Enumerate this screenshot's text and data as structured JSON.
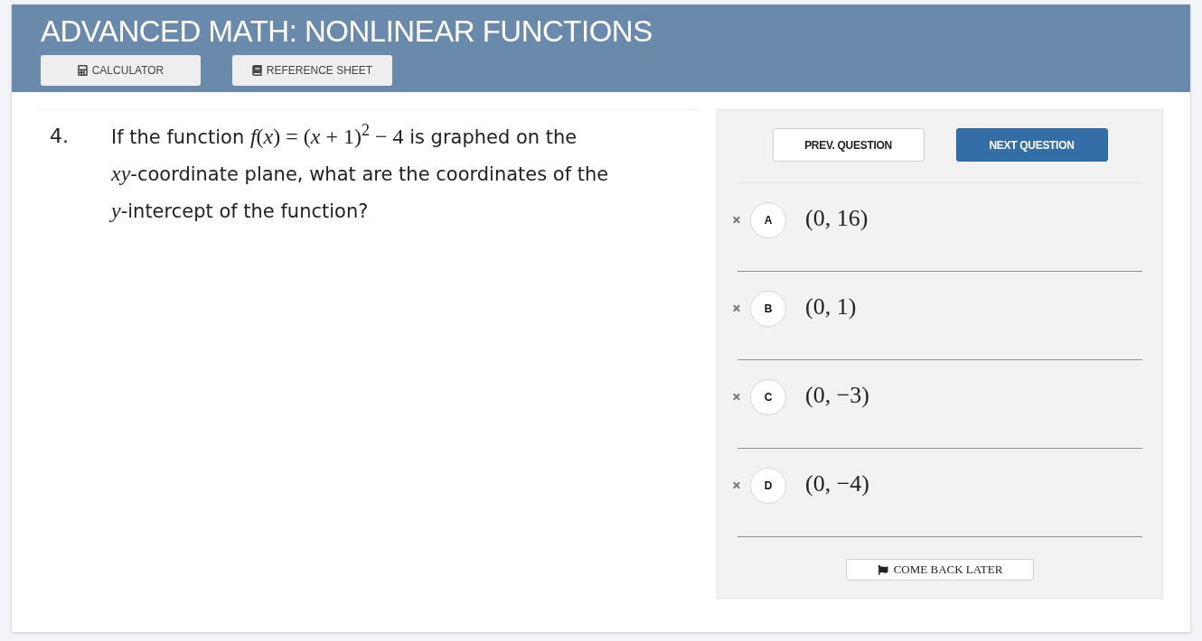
{
  "header": {
    "title": "ADVANCED MATH: NONLINEAR FUNCTIONS",
    "tools": [
      {
        "kind": "calculator",
        "label": "CALCULATOR"
      },
      {
        "kind": "reference",
        "label": "REFERENCE SHEET"
      }
    ]
  },
  "question": {
    "number": "4.",
    "segments": [
      {
        "kind": "text",
        "text": "If the function "
      },
      {
        "kind": "math",
        "text": "*f*(*x*) = (*x* + 1)$^{2}$ − 4"
      },
      {
        "kind": "text",
        "text": " is graphed on the "
      },
      {
        "kind": "math",
        "text": "*xy*"
      },
      {
        "kind": "text",
        "text": "-coordinate plane, what are the coordinates of the "
      },
      {
        "kind": "math",
        "text": "*y*"
      },
      {
        "kind": "text",
        "text": "-intercept of the function?"
      }
    ]
  },
  "navigation": {
    "buttons": [
      {
        "kind": "secondary",
        "label": "PREV. QUESTION"
      },
      {
        "kind": "primary",
        "label": "NEXT QUESTION"
      }
    ]
  },
  "choices": [
    {
      "letter": "A",
      "answer": "(0, 16)",
      "selected": false
    },
    {
      "letter": "B",
      "answer": "(0, 1)",
      "selected": false
    },
    {
      "letter": "C",
      "answer": "(0, −3)",
      "selected": false
    },
    {
      "letter": "D",
      "answer": "(0, −4)",
      "selected": false
    }
  ],
  "come_back_later": {
    "label": "COME BACK LATER"
  }
}
